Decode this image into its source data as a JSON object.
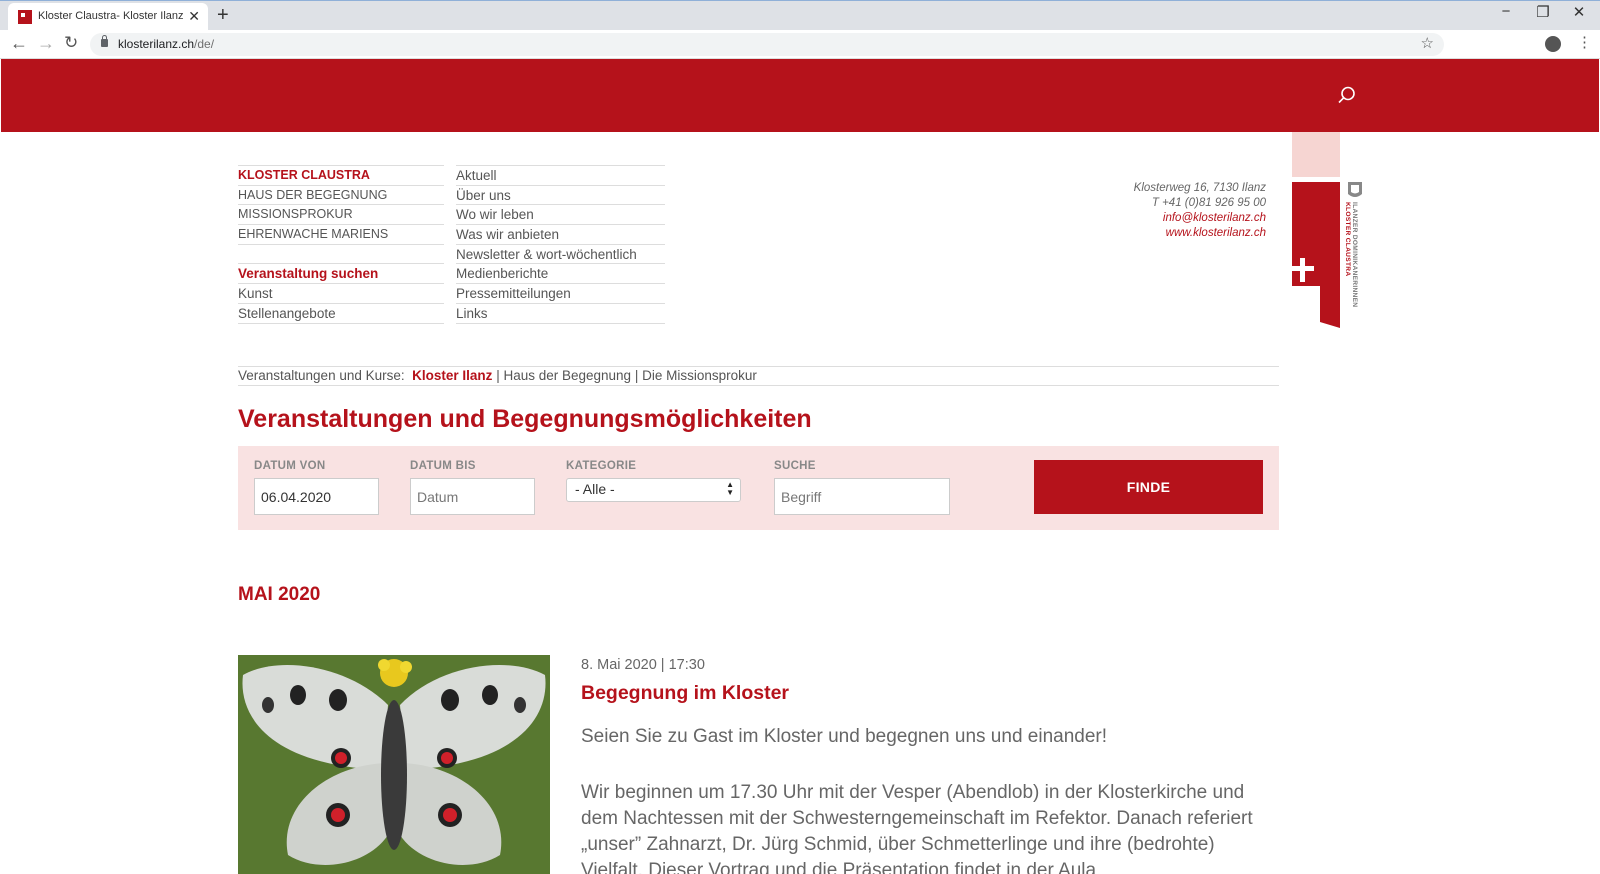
{
  "browser": {
    "tab_title": "Kloster Claustra- Kloster Ilanz",
    "url_host": "klosterilanz.ch",
    "url_path": "/de/"
  },
  "colors": {
    "brand": "#b5121b",
    "filter_bg": "#f9e2e2",
    "logo_light": "#f6d5d2"
  },
  "icons": [
    "search-icon",
    "star-icon",
    "profile-icon",
    "back-icon",
    "forward-icon",
    "reload-icon",
    "close-icon",
    "plus-icon"
  ],
  "nav": {
    "col1": [
      {
        "label": "KLOSTER CLAUSTRA",
        "active": true
      },
      {
        "label": "HAUS DER BEGEGNUNG"
      },
      {
        "label": "MISSIONSPROKUR"
      },
      {
        "label": "EHRENWACHE MARIENS"
      },
      {
        "label": "Veranstaltung suchen",
        "active": true
      },
      {
        "label": "Kunst"
      },
      {
        "label": "Stellenangebote"
      }
    ],
    "col2": [
      "Aktuell",
      "Über uns",
      "Wo wir leben",
      "Was wir anbieten",
      "Newsletter & wort-wöchentlich",
      "Medienberichte",
      "Pressemitteilungen",
      "Links"
    ]
  },
  "contact": {
    "address": "Klosterweg 16, 7130 Ilanz",
    "phone": "T +41 (0)81 926 95 00",
    "email": "info@klosterilanz.ch",
    "web": "www.klosterilanz.ch"
  },
  "logo": {
    "line1": "ILANZER DOMINIKANERINNEN",
    "line2": "KLOSTER CLAUSTRA"
  },
  "crumbs": {
    "prefix": "Veranstaltungen und Kurse:",
    "active": "Kloster Ilanz",
    "sep": "|",
    "item2": "Haus der Begegnung",
    "item3": "Die Missionsprokur"
  },
  "page_title": "Veranstaltungen und Begegnungsmöglichkeiten",
  "filter": {
    "date_from_label": "DATUM VON",
    "date_from_value": "06.04.2020",
    "date_to_label": "DATUM BIS",
    "date_to_placeholder": "Datum",
    "category_label": "KATEGORIE",
    "category_value": "- Alle -",
    "search_label": "SUCHE",
    "search_placeholder": "Begriff",
    "button": "FINDE"
  },
  "month": "MAI 2020",
  "event": {
    "date": "8. Mai 2020 | 17:30",
    "title": "Begegnung im Kloster",
    "lead": "Seien Sie zu Gast im Kloster und begegnen uns und einander!",
    "body": "Wir beginnen um 17.30 Uhr mit der Vesper (Abendlob) in der Klosterkirche und dem Nachtessen mit der Schwesterngemeinschaft im Refektor. Danach referiert „unser” Zahnarzt, Dr. Jürg Schmid, über Schmetterlinge und ihre (bedrohte) Vielfalt. Dieser Vortrag und die Präsentation findet in der Aula"
  }
}
